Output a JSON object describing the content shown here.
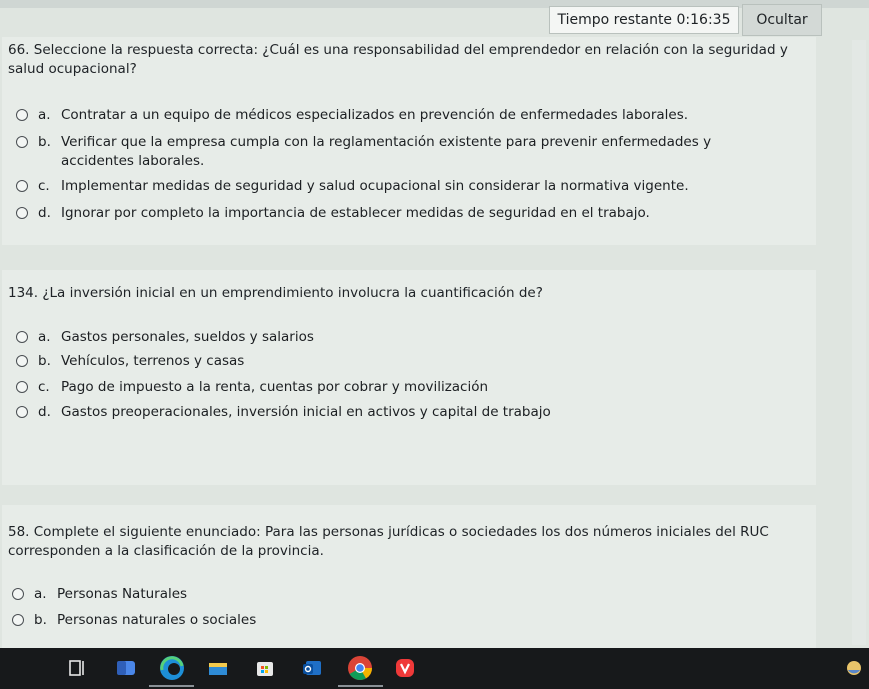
{
  "header": {
    "timer_label": "Tiempo restante",
    "timer_value": "0:16:35",
    "hide_button": "Ocultar"
  },
  "questions": [
    {
      "text": "66. Seleccione la respuesta correcta: ¿Cuál es una responsabilidad del emprendedor en relación con la seguridad y salud ocupacional?",
      "options": [
        {
          "letter": "a.",
          "text": "Contratar a un equipo de médicos especializados en prevención de enfermedades laborales."
        },
        {
          "letter": "b.",
          "text": "Verificar que la empresa cumpla con la reglamentación existente para prevenir enfermedades y accidentes laborales."
        },
        {
          "letter": "c.",
          "text": "Implementar medidas de seguridad y salud ocupacional sin considerar la normativa vigente."
        },
        {
          "letter": "d.",
          "text": "Ignorar por completo la importancia de establecer medidas de seguridad en el trabajo."
        }
      ]
    },
    {
      "text": "134. ¿La inversión inicial en un emprendimiento involucra la cuantificación de?",
      "options": [
        {
          "letter": "a.",
          "text": "Gastos personales, sueldos y salarios"
        },
        {
          "letter": "b.",
          "text": "Vehículos, terrenos y casas"
        },
        {
          "letter": "c.",
          "text": "Pago de impuesto a la renta, cuentas por cobrar y movilización"
        },
        {
          "letter": "d.",
          "text": "Gastos preoperacionales, inversión inicial en activos y capital de trabajo"
        }
      ]
    },
    {
      "text": "58. Complete el siguiente enunciado: Para las personas jurídicas o sociedades los dos números iniciales del RUC corresponden a la clasificación de la provincia.",
      "options": [
        {
          "letter": "a.",
          "text": "Personas Naturales"
        },
        {
          "letter": "b.",
          "text": "Personas naturales o sociales"
        }
      ]
    }
  ],
  "taskbar": {
    "icons": [
      "task-view-icon",
      "onenote-icon",
      "edge-icon",
      "file-explorer-icon",
      "store-icon",
      "outlook-icon",
      "chrome-icon",
      "vivaldi-icon"
    ]
  }
}
